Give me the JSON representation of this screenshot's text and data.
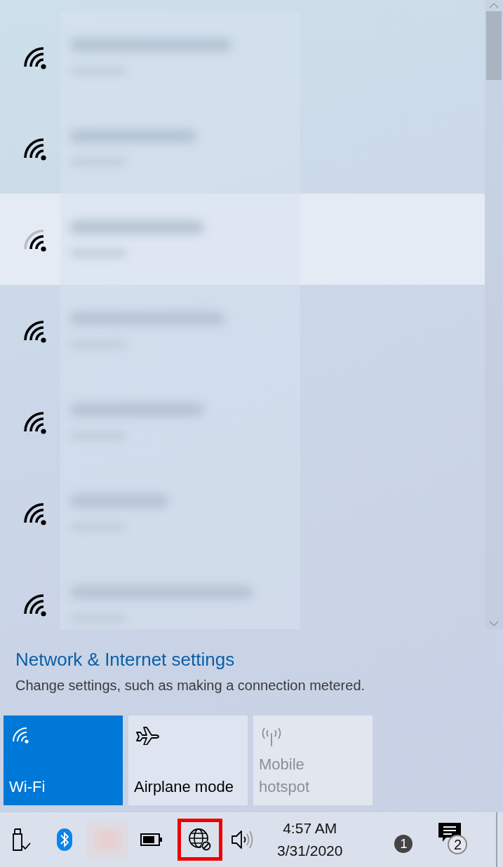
{
  "networks": [
    {
      "kind": "strong",
      "selected": false
    },
    {
      "kind": "strong",
      "selected": false
    },
    {
      "kind": "medium",
      "selected": true
    },
    {
      "kind": "strong",
      "selected": false
    },
    {
      "kind": "strong",
      "selected": false
    },
    {
      "kind": "strong",
      "selected": false
    },
    {
      "kind": "strong",
      "selected": false
    }
  ],
  "settings_link": "Network & Internet settings",
  "settings_description": "Change settings, such as making a connection metered.",
  "quick_actions": [
    {
      "kind": "wifi",
      "lines": [
        "Wi-Fi"
      ],
      "on": true,
      "disabled": false
    },
    {
      "kind": "airplane",
      "lines": [
        "Airplane mode"
      ],
      "on": false,
      "disabled": false
    },
    {
      "kind": "hotspot",
      "lines": [
        "Mobile",
        "hotspot"
      ],
      "on": false,
      "disabled": true
    }
  ],
  "tray": [
    {
      "kind": "usb",
      "highlighted": false
    },
    {
      "kind": "bluetooth",
      "highlighted": false
    },
    {
      "kind": "app",
      "highlighted": false
    },
    {
      "kind": "battery",
      "highlighted": false
    },
    {
      "kind": "network",
      "highlighted": true
    },
    {
      "kind": "volume",
      "highlighted": false
    }
  ],
  "clock": {
    "time": "4:57 AM",
    "date": "3/31/2020"
  },
  "people_badge": "1",
  "notification_count": "2"
}
